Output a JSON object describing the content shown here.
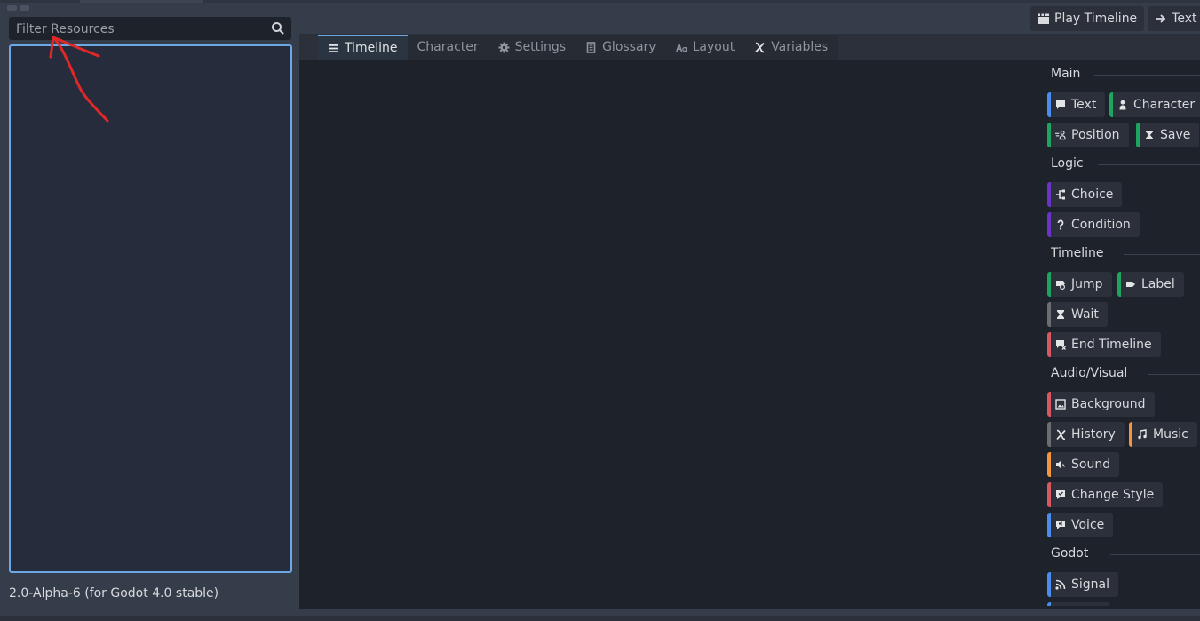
{
  "filter": {
    "placeholder": "Filter Resources"
  },
  "version_label": "2.0-Alpha-6 (for Godot 4.0 stable)",
  "top_buttons": {
    "play": "Play Timeline",
    "text_editor": "Text Ec"
  },
  "tabs": [
    {
      "label": "Timeline",
      "icon": "list-icon",
      "active": true
    },
    {
      "label": "Character",
      "icon": "",
      "active": false
    },
    {
      "label": "Settings",
      "icon": "gear-icon",
      "active": false
    },
    {
      "label": "Glossary",
      "icon": "book-icon",
      "active": false
    },
    {
      "label": "Layout",
      "icon": "font-icon",
      "active": false
    },
    {
      "label": "Variables",
      "icon": "variable-icon",
      "active": false
    }
  ],
  "palette": {
    "main": {
      "title": "Main",
      "text": "Text",
      "character": "Character",
      "position": "Position",
      "save": "Save"
    },
    "logic": {
      "title": "Logic",
      "choice": "Choice",
      "condition": "Condition"
    },
    "timeline": {
      "title": "Timeline",
      "jump": "Jump",
      "label": "Label",
      "wait": "Wait",
      "end_timeline": "End Timeline"
    },
    "audio_visual": {
      "title": "Audio/Visual",
      "background": "Background",
      "history": "History",
      "music": "Music",
      "sound": "Sound",
      "change_style": "Change Style",
      "voice": "Voice"
    },
    "godot": {
      "title": "Godot",
      "signal": "Signal"
    }
  },
  "colors": {
    "blue": "#4c8bf0",
    "green": "#1fa361",
    "purple": "#6b34c8",
    "gray": "#6e6e6e",
    "red": "#d9575f",
    "orange": "#f5953c",
    "accent": "#6ea8e4",
    "annotation": "#e02828"
  }
}
